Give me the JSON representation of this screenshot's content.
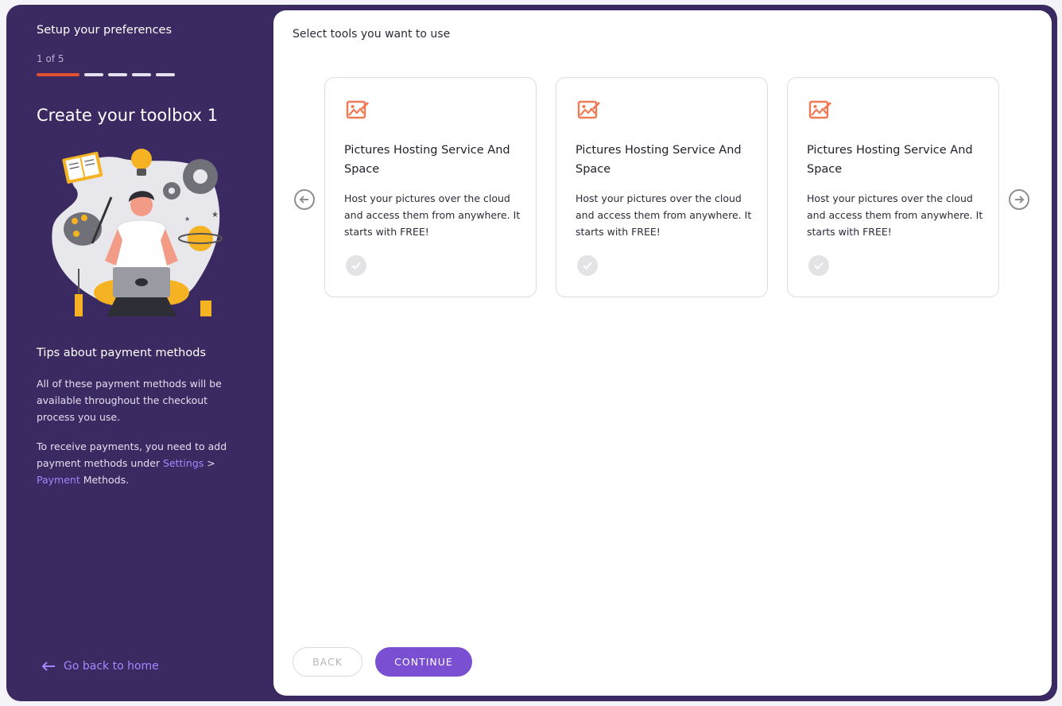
{
  "sidebar": {
    "setup_title": "Setup your preferences",
    "step_count": "1 of 5",
    "progress": {
      "current_step": 1,
      "total_steps": 5
    },
    "create_title": "Create your toolbox 1",
    "tips_title": "Tips about payment methods",
    "tips_paragraph_1": "All of these payment methods will be available throughout the checkout process you use.",
    "tips_paragraph_2_prefix": "To receive payments, you need to add payment methods under ",
    "tips_link_settings": "Settings",
    "tips_separator": " > ",
    "tips_link_payment": "Payment",
    "tips_paragraph_2_suffix": " Methods.",
    "go_home_label": "Go back to home"
  },
  "main": {
    "title": "Select tools you want to use",
    "cards": [
      {
        "title": "Pictures Hosting Service And Space",
        "description": "Host your pictures over the cloud and access them from anywhere. It starts with FREE!",
        "icon": "image-edit-icon",
        "selected": false
      },
      {
        "title": "Pictures Hosting Service And Space",
        "description": "Host your pictures over the cloud and access them from anywhere. It starts with FREE!",
        "icon": "image-edit-icon",
        "selected": false
      },
      {
        "title": "Pictures Hosting Service And Space",
        "description": "Host your pictures over the cloud and access them from anywhere. It starts with FREE!",
        "icon": "image-edit-icon",
        "selected": false
      }
    ],
    "back_label": "BACK",
    "continue_label": "CONTINUE"
  },
  "colors": {
    "sidebar_bg": "#3b2a61",
    "accent": "#7a4fd1",
    "progress_active": "#e1502f",
    "link": "#a486ff",
    "icon_orange": "#f07a55"
  }
}
